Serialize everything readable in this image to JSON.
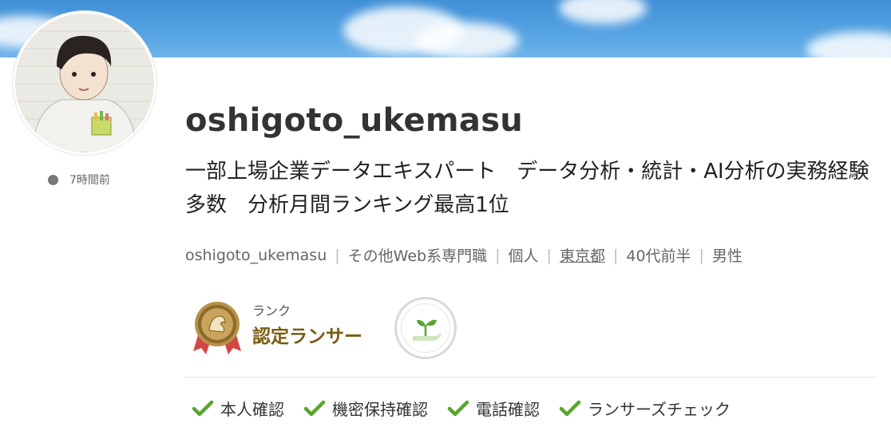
{
  "profile": {
    "username": "oshigoto_ukemasu",
    "catchphrase": "一部上場企業データエキスパート　データ分析・統計・AI分析の実務経験多数　分析月間ランキング最高1位",
    "last_login": "7時間前",
    "avatar_icon": "user-avatar-illustration"
  },
  "meta": {
    "items": [
      {
        "text": "oshigoto_ukemasu",
        "link": false
      },
      {
        "text": "その他Web系専門職",
        "link": false
      },
      {
        "text": "個人",
        "link": false
      },
      {
        "text": "東京都",
        "link": true
      },
      {
        "text": "40代前半",
        "link": false
      },
      {
        "text": "男性",
        "link": false
      }
    ],
    "separator": "|"
  },
  "rank": {
    "label": "ランク",
    "name": "認定ランサー",
    "medal_icon": "certified-medal-icon",
    "badge_icon": "sprout-hand-icon"
  },
  "verifications": [
    {
      "label": "本人確認",
      "icon": "check-icon"
    },
    {
      "label": "機密保持確認",
      "icon": "check-icon"
    },
    {
      "label": "電話確認",
      "icon": "check-icon"
    },
    {
      "label": "ランサーズチェック",
      "icon": "check-icon"
    }
  ],
  "colors": {
    "cover_sky": "#4a98dc",
    "rank_name": "#7a5c14",
    "check_green": "#5aa52f",
    "status_dot": "#777777"
  }
}
